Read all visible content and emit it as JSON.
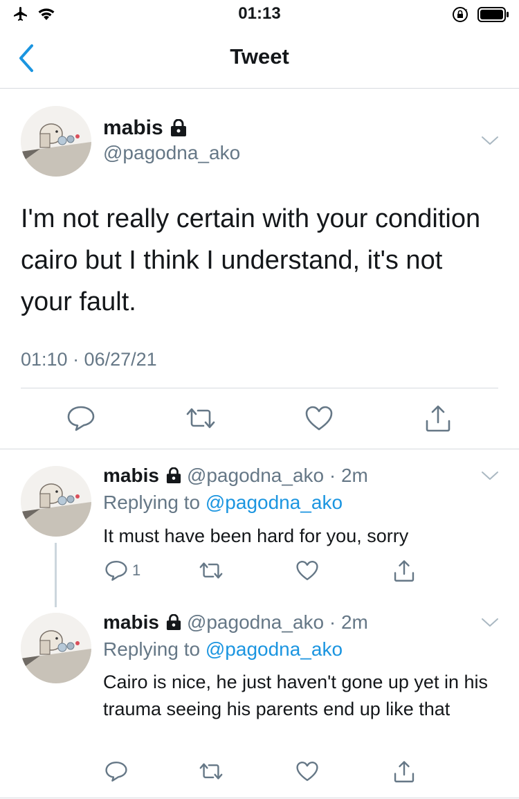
{
  "status_bar": {
    "time": "01:13"
  },
  "nav": {
    "title": "Tweet"
  },
  "main_tweet": {
    "name": "mabis",
    "handle": "@pagodna_ako",
    "text": "I'm not really certain with your condition cairo but I think I understand, it's not your fault.",
    "timestamp": "01:10 · 06/27/21"
  },
  "replies": [
    {
      "name": "mabis",
      "handle_time": "@pagodna_ako · 2m",
      "replying_prefix": "Replying to",
      "replying_to": "@pagodna_ako",
      "text": "It must have been hard for you, sorry",
      "reply_count": "1"
    },
    {
      "name": "mabis",
      "handle_time": "@pagodna_ako · 2m",
      "replying_prefix": "Replying to",
      "replying_to": "@pagodna_ako",
      "text": "Cairo is nice, he just haven't gone up yet in his trauma seeing his parents end up like that",
      "reply_count": ""
    }
  ],
  "colors": {
    "accent": "#1b95e0",
    "secondary_text": "#657786",
    "divider": "#d6dade"
  },
  "icons": [
    "airplane-icon",
    "wifi-icon",
    "orientation-lock-icon",
    "battery-icon",
    "back-chevron-icon",
    "lock-icon",
    "chevron-down-icon",
    "reply-icon",
    "retweet-icon",
    "like-icon",
    "share-icon"
  ]
}
